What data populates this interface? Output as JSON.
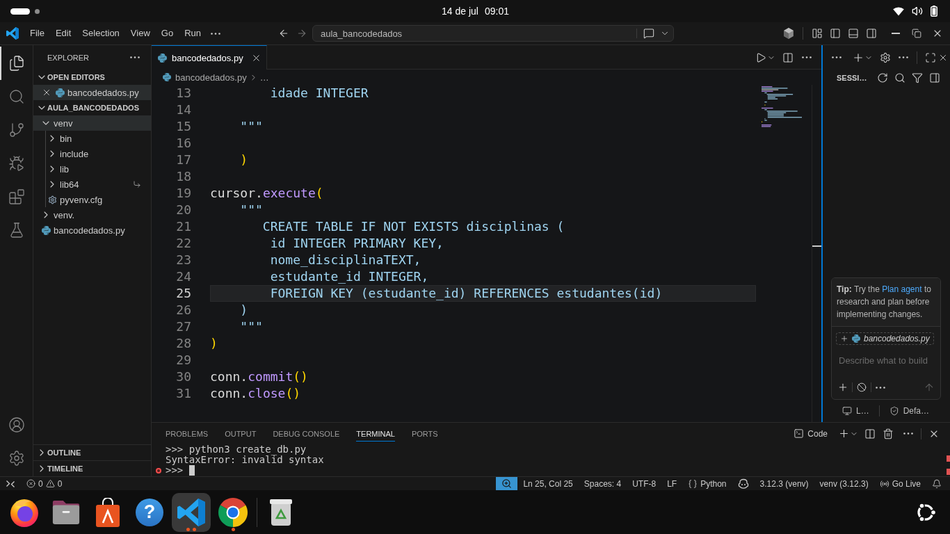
{
  "top_bar": {
    "workspaces": [
      {
        "selected": true
      },
      {
        "selected": false
      }
    ],
    "date": "14 de jul",
    "time": "09:01"
  },
  "title_bar": {
    "menu": [
      "File",
      "Edit",
      "Selection",
      "View",
      "Go",
      "Run"
    ],
    "command_center": "aula_bancodedados"
  },
  "activity_bar": [
    {
      "kind": "explorer",
      "selected": true
    },
    {
      "kind": "search",
      "selected": false
    },
    {
      "kind": "source-control",
      "selected": false
    },
    {
      "kind": "run-debug",
      "selected": false
    },
    {
      "kind": "extensions",
      "selected": false
    },
    {
      "kind": "testing",
      "selected": false
    }
  ],
  "explorer": {
    "title": "EXPLORER",
    "open_editors": {
      "title": "OPEN EDITORS",
      "expanded": true,
      "items": [
        {
          "name": "bancodedados.py",
          "selected": true
        }
      ]
    },
    "folder": {
      "title": "AULA_BANCODEDADOS",
      "expanded": true,
      "items": [
        {
          "kind": "folder",
          "name": "venv",
          "expanded": true,
          "selected": true,
          "symlink": false,
          "children": [
            {
              "kind": "folder",
              "name": "bin",
              "expanded": false,
              "selected": false,
              "symlink": false
            },
            {
              "kind": "folder",
              "name": "include",
              "expanded": false,
              "selected": false,
              "symlink": false
            },
            {
              "kind": "folder",
              "name": "lib",
              "expanded": false,
              "selected": false,
              "symlink": false
            },
            {
              "kind": "folder",
              "name": "lib64",
              "expanded": false,
              "selected": false,
              "symlink": true
            },
            {
              "kind": "config",
              "name": "pyvenv.cfg",
              "selected": false,
              "symlink": false
            }
          ]
        },
        {
          "kind": "folder",
          "name": "venv.",
          "expanded": false,
          "selected": false,
          "symlink": false
        },
        {
          "kind": "python",
          "name": "bancodedados.py",
          "selected": false,
          "symlink": false
        }
      ]
    },
    "outline": {
      "title": "OUTLINE",
      "expanded": false
    },
    "timeline": {
      "title": "TIMELINE",
      "expanded": false
    }
  },
  "editor": {
    "tabs": [
      {
        "name": "bancodedados.py",
        "selected": true
      }
    ],
    "breadcrumb": [
      "bancodedados.py",
      "…"
    ],
    "lines": [
      {
        "number": "13",
        "current": false,
        "tokens": [
          {
            "kind": "string",
            "text": "        idade INTEGER"
          }
        ]
      },
      {
        "number": "14",
        "current": false
      },
      {
        "number": "15",
        "current": false,
        "tokens": [
          {
            "kind": "string",
            "text": "    \"\"\""
          }
        ]
      },
      {
        "number": "16",
        "current": false
      },
      {
        "number": "17",
        "current": false,
        "tokens": [
          {
            "kind": "bracket",
            "text": "    )"
          }
        ]
      },
      {
        "number": "18",
        "current": false
      },
      {
        "number": "19",
        "current": false,
        "tokens": [
          {
            "kind": "variable",
            "text": "cursor"
          },
          {
            "kind": "punct",
            "text": "."
          },
          {
            "kind": "method",
            "text": "execute"
          },
          {
            "kind": "bracket",
            "text": "("
          }
        ]
      },
      {
        "number": "20",
        "current": false,
        "tokens": [
          {
            "kind": "string",
            "text": "    \"\"\""
          }
        ]
      },
      {
        "number": "21",
        "current": false,
        "tokens": [
          {
            "kind": "string",
            "text": "       CREATE TABLE IF NOT EXISTS disciplinas ("
          }
        ]
      },
      {
        "number": "22",
        "current": false,
        "tokens": [
          {
            "kind": "string",
            "text": "        id INTEGER PRIMARY KEY,"
          }
        ]
      },
      {
        "number": "23",
        "current": false,
        "tokens": [
          {
            "kind": "string",
            "text": "        nome_disciplinaTEXT,"
          }
        ]
      },
      {
        "number": "24",
        "current": false,
        "tokens": [
          {
            "kind": "string",
            "text": "        estudante_id INTEGER,"
          }
        ]
      },
      {
        "number": "25",
        "current": true,
        "tokens": [
          {
            "kind": "string",
            "text": "        FOREIGN KEY (estudante_id) REFERENCES estudantes(id)"
          }
        ]
      },
      {
        "number": "26",
        "current": false,
        "tokens": [
          {
            "kind": "string",
            "text": "    )"
          }
        ]
      },
      {
        "number": "27",
        "current": false,
        "tokens": [
          {
            "kind": "string",
            "text": "    \"\"\""
          }
        ]
      },
      {
        "number": "28",
        "current": false,
        "tokens": [
          {
            "kind": "bracket",
            "text": ")"
          }
        ]
      },
      {
        "number": "29",
        "current": false
      },
      {
        "number": "30",
        "current": false,
        "tokens": [
          {
            "kind": "variable",
            "text": "conn"
          },
          {
            "kind": "punct",
            "text": "."
          },
          {
            "kind": "method",
            "text": "commit"
          },
          {
            "kind": "bracket",
            "text": "()"
          }
        ]
      },
      {
        "number": "31",
        "current": false,
        "tokens": [
          {
            "kind": "variable",
            "text": "conn"
          },
          {
            "kind": "punct",
            "text": "."
          },
          {
            "kind": "method",
            "text": "close"
          },
          {
            "kind": "bracket",
            "text": "()"
          }
        ]
      }
    ]
  },
  "chat": {
    "title": "SESSI…",
    "tip": {
      "lead": "Tip:",
      "text": "Try the",
      "link": "Plan agent",
      "rest": "to research and plan before implementing changes."
    },
    "attachment": "bancodedados.py",
    "placeholder": "Describe what to build",
    "footer": [
      {
        "kind": "target",
        "label": "L…"
      },
      {
        "kind": "approvals",
        "label": "Defa…"
      }
    ]
  },
  "panel": {
    "tabs": [
      {
        "label": "PROBLEMS",
        "selected": false
      },
      {
        "label": "OUTPUT",
        "selected": false
      },
      {
        "label": "DEBUG CONSOLE",
        "selected": false
      },
      {
        "label": "TERMINAL",
        "selected": true
      },
      {
        "label": "PORTS",
        "selected": false
      }
    ],
    "terminal_name": "Code",
    "lines": [
      ">>> python3 create_db.py",
      "SyntaxError: invalid syntax"
    ],
    "prompt": {
      "text": ">>>",
      "error": true
    }
  },
  "status_bar": {
    "errors": "0",
    "warnings": "0",
    "items": [
      {
        "kind": "zoom"
      },
      {
        "kind": "text",
        "label": "Ln 25, Col 25"
      },
      {
        "kind": "text",
        "label": "Spaces: 4"
      },
      {
        "kind": "text",
        "label": "UTF-8"
      },
      {
        "kind": "text",
        "label": "LF"
      },
      {
        "kind": "language",
        "label": "Python"
      },
      {
        "kind": "copilot"
      },
      {
        "kind": "text",
        "label": "3.12.3 (venv)"
      },
      {
        "kind": "text",
        "label": "venv (3.12.3)"
      },
      {
        "kind": "live",
        "label": "Go Live"
      },
      {
        "kind": "notifications"
      }
    ]
  },
  "dock": [
    {
      "kind": "firefox",
      "selected": false,
      "running": false,
      "multiple_windows": false
    },
    {
      "kind": "files",
      "selected": false,
      "running": false,
      "multiple_windows": false
    },
    {
      "kind": "app-center",
      "selected": false,
      "running": false,
      "multiple_windows": false
    },
    {
      "kind": "help",
      "glyph": "?",
      "selected": false,
      "running": false,
      "multiple_windows": false
    },
    {
      "kind": "vscode",
      "selected": true,
      "running": true,
      "multiple_windows": true
    },
    {
      "kind": "chrome",
      "selected": false,
      "running": true,
      "multiple_windows": false
    },
    {
      "kind": "trash",
      "selected": false,
      "running": false,
      "multiple_windows": false
    }
  ]
}
